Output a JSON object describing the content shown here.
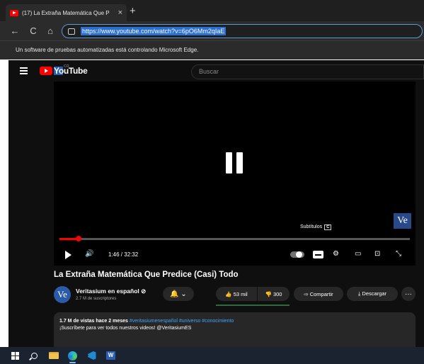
{
  "browser": {
    "tab_title": "(17) La Extraña Matemática Que P",
    "tab_close": "×",
    "new_tab": "+",
    "url": "https://www.youtube.com/watch?v=6pO6Mm2qIaE",
    "back_icon": "←",
    "refresh_icon": "C",
    "home_icon": "⌂",
    "automation_notice": "Un software de pruebas automatizadas está controlando Microsoft Edge."
  },
  "youtube": {
    "logo_text": "YouTube",
    "logo_country": "CO",
    "search_placeholder": "Buscar",
    "player": {
      "subtitles_tip": "Subtítulos",
      "subtitles_key": "C",
      "watermark": "Ve",
      "time": "1:46 / 32:32",
      "progress_fraction": 0.054,
      "volume_icon": "🔊",
      "settings_icon": "⚙",
      "theater_icon": "▭",
      "cast_icon": "⊡",
      "fullscreen_icon": "⤡"
    },
    "video_title": "La Extraña Matemática Que Predice (Casi) Todo",
    "channel": {
      "avatar_text": "Ve",
      "name": "Veritasium en español ⊘",
      "subscribers": "2.7 M de suscriptores",
      "bell": "🔔 ⌄"
    },
    "actions": {
      "likes": "👍 53 mil",
      "dislikes": "👎 300",
      "share": "⇨ Compartir",
      "download": "⤓ Descargar",
      "more": "···"
    },
    "description": {
      "meta": "1.7 M de vistas  hace 2 meses",
      "hashtags": " #veritasiumenespañol #universo #conocimiento",
      "line2": "¡Suscríbete para ver todos nuestros videos! @VeritasiumES"
    }
  },
  "taskbar": {
    "word_letter": "W"
  },
  "colors": {
    "accent_red": "#ff0000",
    "link_blue": "#3ea6ff",
    "page_bg": "#0f0f0f"
  }
}
